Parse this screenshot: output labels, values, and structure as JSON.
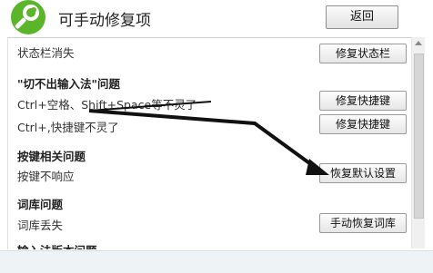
{
  "header": {
    "logo_icon": "wrench-icon",
    "title": "可手动修复项",
    "back_label": "返回",
    "logo_color": "#5bb52a"
  },
  "items": {
    "statusbar": {
      "label": "状态栏消失",
      "button": "修复状态栏"
    },
    "section_input": {
      "heading": "\"切不出输入法\"问题"
    },
    "ctrl_space": {
      "label": "Ctrl+空格、Shift+Space等不灵了",
      "button": "修复快捷键"
    },
    "ctrl_comma": {
      "label": "Ctrl+,快捷键不灵了",
      "button": "修复快捷键"
    },
    "section_keys": {
      "heading": "按键相关问题"
    },
    "keys_unresponsive": {
      "label": "按键不响应",
      "button": "恢复默认设置"
    },
    "section_dict": {
      "heading": "词库问题"
    },
    "dict_lost": {
      "label": "词库丢失",
      "button": "手动恢复词库"
    },
    "section_version": {
      "heading": "输入法版本问题"
    }
  },
  "annotation": {
    "arrow_color": "#111111"
  }
}
